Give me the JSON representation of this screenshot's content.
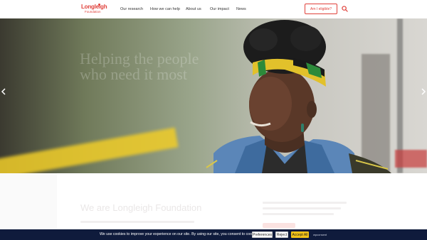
{
  "header": {
    "logo": {
      "name": "Longleigh",
      "sub": "Foundation"
    },
    "nav": [
      "Our research",
      "How we can help",
      "About us",
      "Our impact",
      "News"
    ],
    "cta": "Am I eligible?"
  },
  "hero": {
    "title": "Helping the people who need it most"
  },
  "intro": {
    "heading": "We are Longleigh Foundation"
  },
  "cookie": {
    "message": "We use cookies to improve your experience on our site. By using our site, you consent to cookies.",
    "preferences": "Preferences",
    "reject": "Reject",
    "accept": "Accept All",
    "brand": "wpconsent"
  },
  "colors": {
    "brand": "#e0403a",
    "cookie_bg": "#0f1b3c",
    "accept": "#f3c319"
  },
  "icons": [
    "search-icon",
    "chevron-left-icon",
    "chevron-right-icon"
  ]
}
